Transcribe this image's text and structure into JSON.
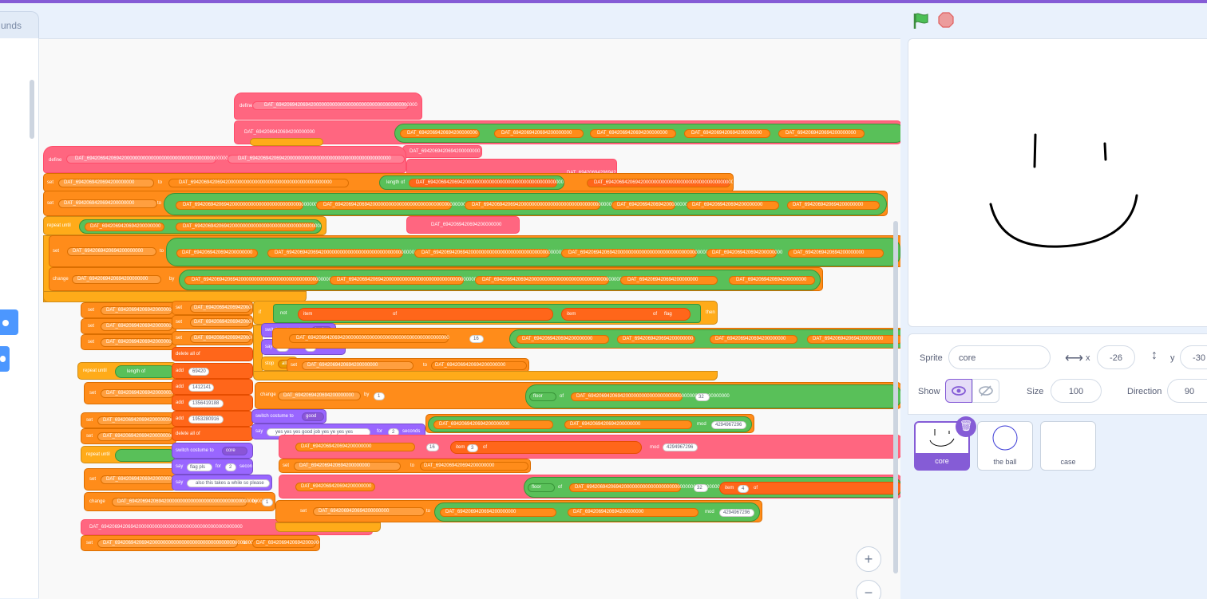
{
  "editor": {
    "tab_label": "unds",
    "blocks": {
      "define_1": "define",
      "var_long": "DAT_69420694206942000000000000000000000000000000000000000",
      "var_short": "DAT_6942069420694200000000",
      "define_2": "define",
      "set": "set",
      "to": "to",
      "repeat_until": "repeat until",
      "change": "change",
      "by": "by",
      "if_label": "if",
      "not_label": "not",
      "item_label": "item",
      "of_label": "of",
      "flag_label": "flag",
      "then_label": "then",
      "switch_costume_to": "switch costume to",
      "costume_bad": "bad",
      "costume_good": "good",
      "costume_core": "core",
      "say": "say",
      "say_no": "NO.",
      "for_label": "for",
      "seconds": "seconds",
      "two": "2",
      "stop": "stop",
      "stop_all": "all",
      "say_yes": "yes yes yes good job yes ye yes yes",
      "say_flag_pls": "flag pls",
      "say_also": "also this takes a while so please",
      "delete_all_of": "delete all of",
      "add": "add",
      "n1": "69420",
      "n2": "1412141",
      "n3": "1356419188",
      "n4": "1953280916",
      "sixteen": "16",
      "three": "3",
      "four": "4",
      "thirty_two": "32",
      "one": "1",
      "floor_label": "floor",
      "mod_label": "mod",
      "mod_val": "4294967296",
      "length_of": "length of",
      "x42": "DAT_694206942069420000000000000000000000000000000000"
    }
  },
  "stage": {
    "flag_icon": "green-flag-icon",
    "stop_icon": "stop-icon"
  },
  "sprite_info": {
    "sprite_label": "Sprite",
    "sprite_name": "core",
    "x_label": "x",
    "x_value": "-26",
    "y_label": "y",
    "y_value": "-30",
    "show_label": "Show",
    "size_label": "Size",
    "size_value": "100",
    "direction_label": "Direction",
    "direction_value": "90"
  },
  "sprites": [
    {
      "name": "core"
    },
    {
      "name": "the ball"
    },
    {
      "name": "case"
    }
  ],
  "colors": {
    "accent": "#855cd6",
    "motion": "#4c97ff",
    "variables": "#ff8c1a",
    "operators": "#59c059",
    "control": "#ffab19",
    "myblocks": "#ff6680",
    "looks": "#9966ff"
  }
}
